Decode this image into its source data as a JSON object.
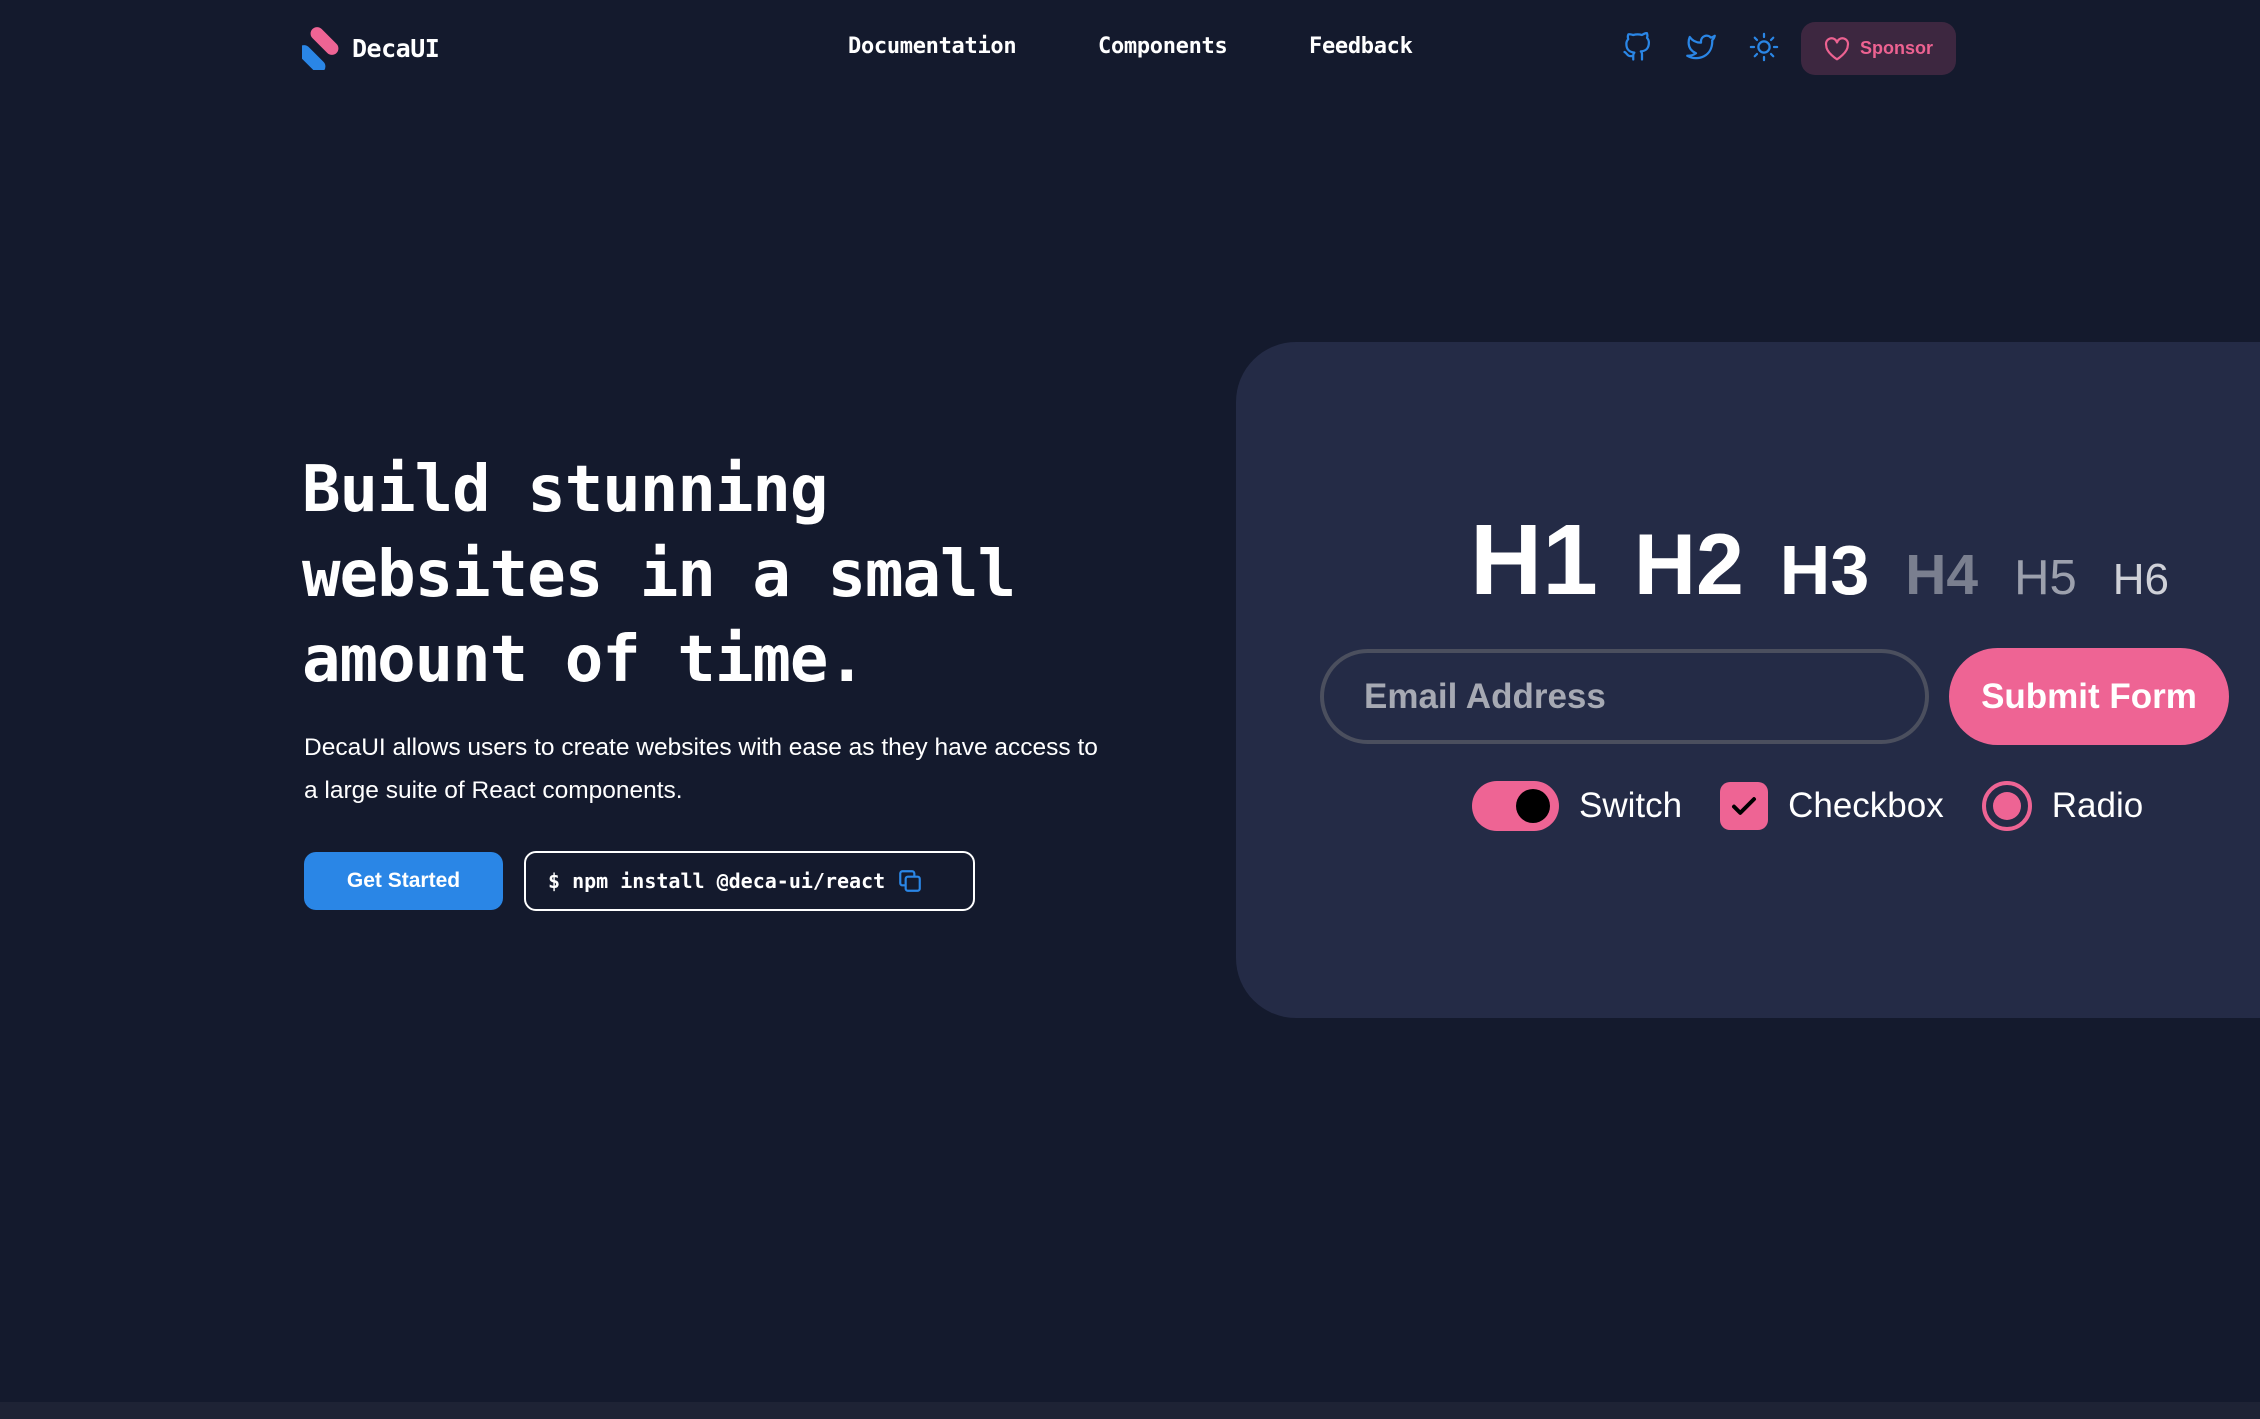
{
  "header": {
    "brand": "DecaUI",
    "nav": [
      "Documentation",
      "Components",
      "Feedback"
    ],
    "icons": [
      "github-icon",
      "twitter-icon",
      "sun-icon"
    ],
    "sponsor_label": "Sponsor"
  },
  "hero": {
    "headline": "Build stunning websites in a small amount of time.",
    "subtitle": "DecaUI allows users to create websites with ease as they have access to a large suite of React components.",
    "cta_label": "Get Started",
    "install_command": "$ npm install @deca-ui/react"
  },
  "preview": {
    "headings": [
      "H1",
      "H2",
      "H3",
      "H4",
      "H5",
      "H6"
    ],
    "email_placeholder": "Email Address",
    "submit_label": "Submit Form",
    "switch_label": "Switch",
    "checkbox_label": "Checkbox",
    "radio_label": "Radio",
    "switch_on": true,
    "checkbox_checked": true,
    "radio_selected": true
  },
  "colors": {
    "background": "#141a2d",
    "card": "#242b46",
    "accent_pink": "#ee6494",
    "accent_blue": "#2a86e6"
  }
}
